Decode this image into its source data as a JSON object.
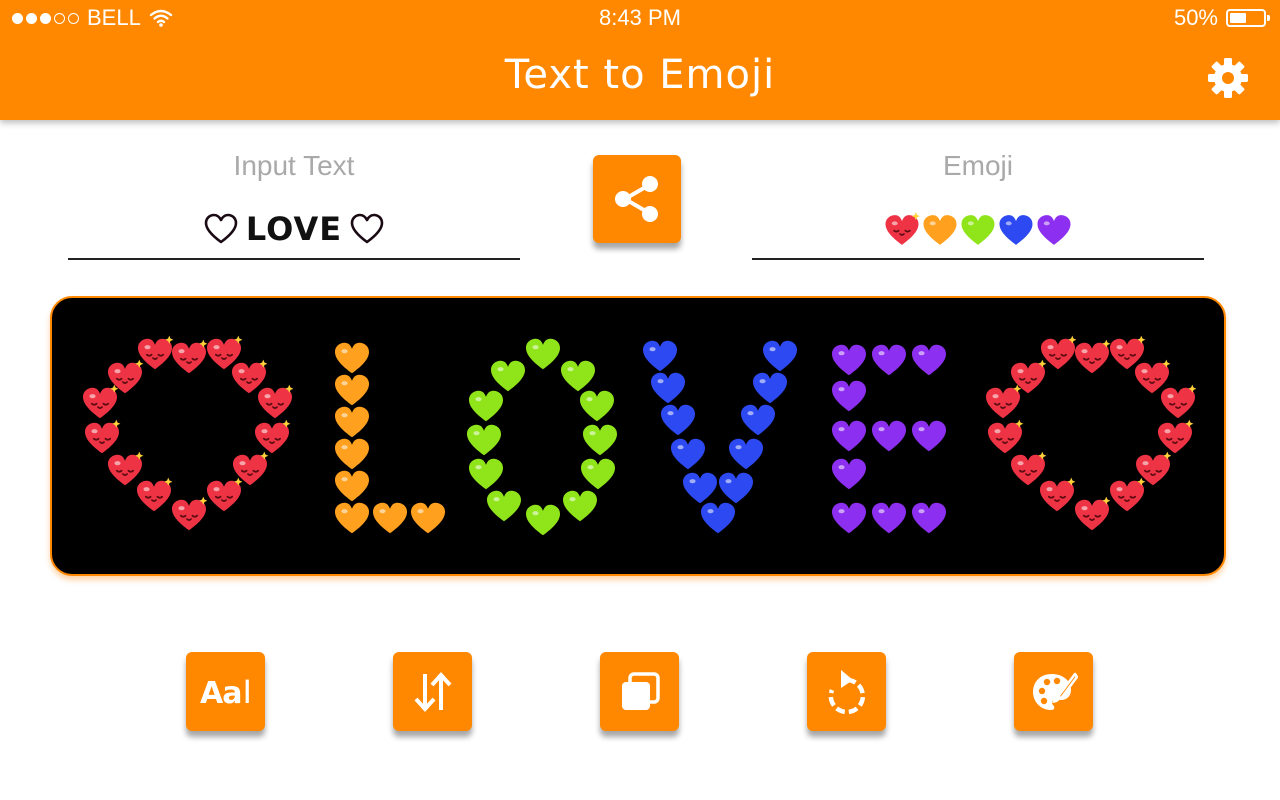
{
  "status_bar": {
    "carrier": "BELL",
    "signal_bars": 3,
    "signal_total": 5,
    "time": "8:43 PM",
    "battery_text": "50%",
    "battery_level": 0.5
  },
  "header": {
    "title": "Text to Emoji",
    "settings_icon": "gear-icon"
  },
  "input_panel": {
    "label": "Input Text",
    "value": "LOVE",
    "decor_icon": "outline-heart-icon"
  },
  "emoji_panel": {
    "label": "Emoji",
    "emojis": [
      "red-heart-face",
      "orange-heart",
      "green-heart",
      "blue-heart",
      "purple-heart"
    ]
  },
  "share_button": {
    "icon": "share-icon"
  },
  "preview": {
    "text": "♡LOVE♡",
    "colors": {
      "red": "#ee3344",
      "orange": "#ffa11f",
      "green": "#8fe51a",
      "blue": "#2d49f2",
      "purple": "#8c2ff0"
    }
  },
  "toolbar": {
    "font_glyph": "Aa",
    "font_cursor": "I",
    "buttons": [
      {
        "icon": "font-icon"
      },
      {
        "icon": "sort-arrows-icon"
      },
      {
        "icon": "copy-icon"
      },
      {
        "icon": "rotate-icon"
      },
      {
        "icon": "palette-icon"
      }
    ]
  },
  "colors": {
    "accent": "#ff8800",
    "canvas_bg": "#000000",
    "label_gray": "#a9a9a9"
  }
}
